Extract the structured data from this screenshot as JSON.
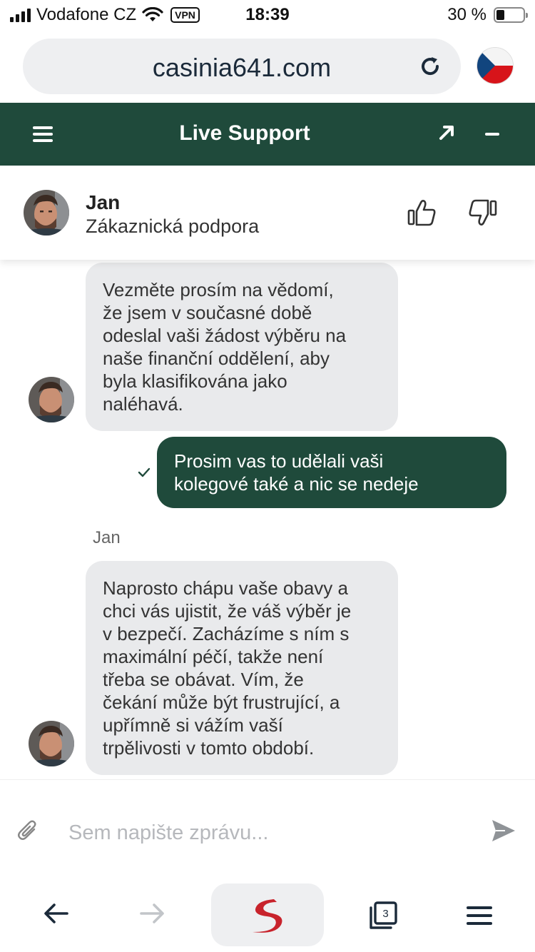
{
  "status_bar": {
    "carrier": "Vodafone CZ",
    "vpn_label": "VPN",
    "time": "18:39",
    "battery": "30 %",
    "battery_level": 0.3
  },
  "browser": {
    "url": "casinia641.com",
    "reload_icon": "reload-icon",
    "flag_icon": "czech-flag-icon"
  },
  "header": {
    "title": "Live Support",
    "menu_icon": "hamburger-icon",
    "popout_icon": "arrow-up-right-icon",
    "minimize_icon": "minimize-icon"
  },
  "agent": {
    "name": "Jan",
    "role": "Zákaznická podpora",
    "like_icon": "thumbs-up-icon",
    "dislike_icon": "thumbs-down-icon"
  },
  "messages": [
    {
      "from": "agent",
      "text": "Vezměte prosím na vědomí,\nže jsem v současné době\nodeslal vaši žádost výběru na\nnaše finanční oddělení, aby\nbyla klasifikována jako\nnaléhavá."
    },
    {
      "from": "user",
      "text": "Prosim vas to udělali vaši\nkolegové také a nic se nedeje",
      "status_icon": "check-icon"
    },
    {
      "from": "agent",
      "sender": "Jan",
      "text": "Naprosto chápu vaše obavy a\nchci vás ujistit, že váš výběr je\nv bezpečí. Zacházíme s ním s\nmaximální péčí, takže není\ntřeba se obávat. Vím, že\nčekání může být frustrující, a\nupřímně si vážím vaší\ntrpělivosti v tomto období."
    }
  ],
  "composer": {
    "placeholder": "Sem napište zprávu...",
    "value": "",
    "attach_icon": "paperclip-icon",
    "send_icon": "send-icon"
  },
  "toolbar": {
    "tab_count": "3",
    "back_icon": "back-arrow-icon",
    "forward_icon": "forward-arrow-icon",
    "home_icon": "browser-logo-icon",
    "tabs_icon": "tabs-icon",
    "menu_icon": "menu-icon"
  },
  "colors": {
    "brand_green": "#1f4a3b",
    "agent_bubble": "#e9eaec",
    "url_bar_bg": "#eeeff1",
    "logo_red": "#c8232c"
  }
}
